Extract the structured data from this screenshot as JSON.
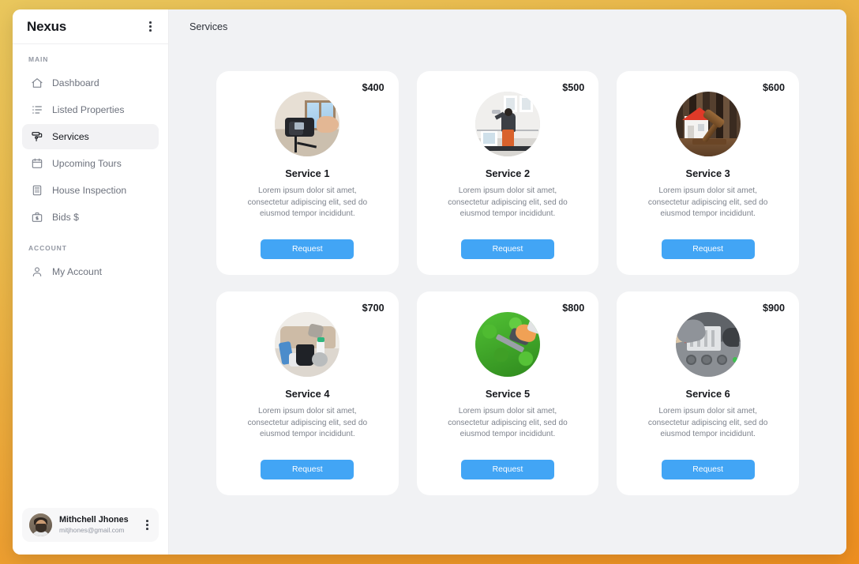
{
  "sidebar": {
    "brand": "Nexus",
    "menu_icon": "kebab-menu-icon",
    "sections": [
      {
        "label": "MAIN",
        "items": [
          {
            "label": "Dashboard",
            "icon": "home-icon",
            "active": false
          },
          {
            "label": "Listed Properties",
            "icon": "list-icon",
            "active": false
          },
          {
            "label": "Services",
            "icon": "paint-roller-icon",
            "active": true
          },
          {
            "label": "Upcoming Tours",
            "icon": "calendar-icon",
            "active": false
          },
          {
            "label": "House Inspection",
            "icon": "building-icon",
            "active": false
          },
          {
            "label": "Bids $",
            "icon": "briefcase-dollar-icon",
            "active": false
          }
        ]
      },
      {
        "label": "ACCOUNT",
        "items": [
          {
            "label": "My Account",
            "icon": "user-icon",
            "active": false
          }
        ]
      }
    ],
    "user": {
      "name": "Mithchell Jhones",
      "email": "mitjhones@gmail.com",
      "avatar": "user-avatar-photo",
      "menu_icon": "kebab-menu-icon"
    }
  },
  "header": {
    "title": "Services"
  },
  "services": [
    {
      "price": "$400",
      "title": "Service 1",
      "description": "Lorem ipsum dolor sit amet, consectetur adipiscing elit, sed do eiusmod tempor incididunt.",
      "button_label": "Request",
      "image": "photography-camera-interior-photo"
    },
    {
      "price": "$500",
      "title": "Service 2",
      "description": "Lorem ipsum dolor sit amet, consectetur adipiscing elit, sed do eiusmod tempor incididunt.",
      "button_label": "Request",
      "image": "house-painter-scaffold-photo"
    },
    {
      "price": "$600",
      "title": "Service 3",
      "description": "Lorem ipsum dolor sit amet, consectetur adipiscing elit, sed do eiusmod tempor incididunt.",
      "button_label": "Request",
      "image": "house-gavel-legal-photo"
    },
    {
      "price": "$700",
      "title": "Service 4",
      "description": "Lorem ipsum dolor sit amet, consectetur adipiscing elit, sed do eiusmod tempor incididunt.",
      "button_label": "Request",
      "image": "cleaning-supplies-living-room-photo"
    },
    {
      "price": "$800",
      "title": "Service 5",
      "description": "Lorem ipsum dolor sit amet, consectetur adipiscing elit, sed do eiusmod tempor incididunt.",
      "button_label": "Request",
      "image": "hedge-trimmer-gardening-photo"
    },
    {
      "price": "$900",
      "title": "Service 6",
      "description": "Lorem ipsum dolor sit amet, consectetur adipiscing elit, sed do eiusmod tempor incididunt.",
      "button_label": "Request",
      "image": "appliance-repair-photo"
    }
  ],
  "colors": {
    "page_gradient_start": "#e9c75d",
    "page_gradient_end": "#ee8f20",
    "main_background": "#f1f2f4",
    "card_background": "#ffffff",
    "accent_button": "#42a5f5",
    "text_primary": "#16181d",
    "text_muted": "#7d828c",
    "active_nav_background": "#f2f2f4"
  }
}
